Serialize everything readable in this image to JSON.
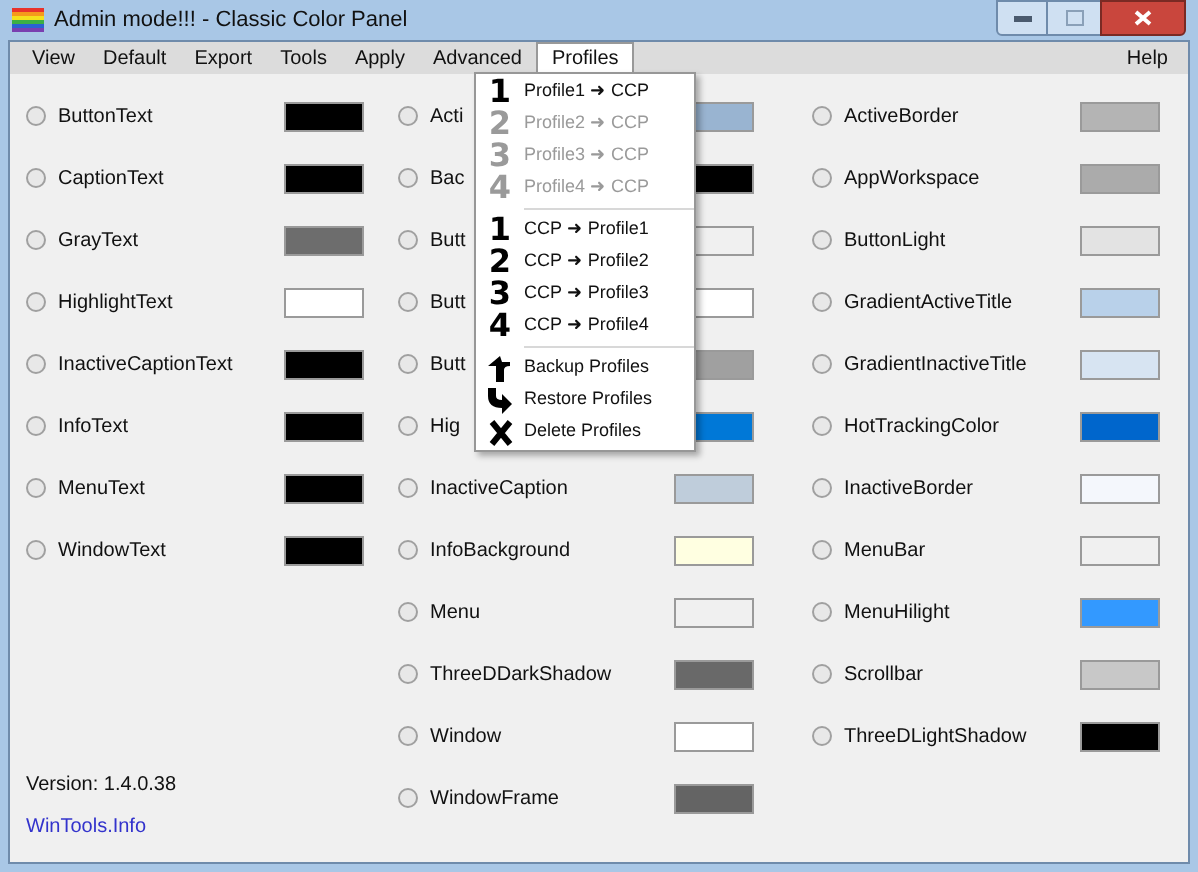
{
  "window": {
    "title": "Admin mode!!! - Classic Color Panel"
  },
  "menu_bar": {
    "items": [
      {
        "label": "View",
        "selected": false
      },
      {
        "label": "Default",
        "selected": false
      },
      {
        "label": "Export",
        "selected": false
      },
      {
        "label": "Tools",
        "selected": false
      },
      {
        "label": "Apply",
        "selected": false
      },
      {
        "label": "Advanced",
        "selected": false
      },
      {
        "label": "Profiles",
        "selected": true
      }
    ],
    "help": "Help"
  },
  "profiles_menu": {
    "groups": [
      [
        {
          "kind": "number",
          "badge": "1",
          "label": "Profile1 ➜ CCP",
          "disabled": false
        },
        {
          "kind": "number",
          "badge": "2",
          "label": "Profile2 ➜ CCP",
          "disabled": true
        },
        {
          "kind": "number",
          "badge": "3",
          "label": "Profile3 ➜ CCP",
          "disabled": true
        },
        {
          "kind": "number",
          "badge": "4",
          "label": "Profile4 ➜ CCP",
          "disabled": true
        }
      ],
      [
        {
          "kind": "number",
          "badge": "1",
          "label": "CCP ➜ Profile1",
          "disabled": false
        },
        {
          "kind": "number",
          "badge": "2",
          "label": "CCP ➜ Profile2",
          "disabled": false
        },
        {
          "kind": "number",
          "badge": "3",
          "label": "CCP ➜ Profile3",
          "disabled": false
        },
        {
          "kind": "number",
          "badge": "4",
          "label": "CCP ➜ Profile4",
          "disabled": false
        }
      ],
      [
        {
          "kind": "backup",
          "label": "Backup Profiles",
          "disabled": false
        },
        {
          "kind": "restore",
          "label": "Restore Profiles",
          "disabled": false
        },
        {
          "kind": "delete",
          "label": "Delete Profiles",
          "disabled": false
        }
      ]
    ]
  },
  "columns": [
    [
      {
        "name": "ButtonText",
        "color": "#000000",
        "selected": false
      },
      {
        "name": "CaptionText",
        "color": "#000000",
        "selected": false
      },
      {
        "name": "GrayText",
        "color": "#6d6d6d",
        "selected": false
      },
      {
        "name": "HighlightText",
        "color": "#ffffff",
        "selected": false
      },
      {
        "name": "InactiveCaptionText",
        "color": "#000000",
        "selected": false
      },
      {
        "name": "InfoText",
        "color": "#000000",
        "selected": false
      },
      {
        "name": "MenuText",
        "color": "#000000",
        "selected": false
      },
      {
        "name": "WindowText",
        "color": "#000000",
        "selected": false
      }
    ],
    [
      {
        "name": "Acti",
        "color": "#99b4d1",
        "selected": false
      },
      {
        "name": "Bac",
        "color": "#000000",
        "selected": false
      },
      {
        "name": "Butt",
        "color": "#f0f0f0",
        "selected": false
      },
      {
        "name": "Butt",
        "color": "#ffffff",
        "selected": false
      },
      {
        "name": "Butt",
        "color": "#a0a0a0",
        "selected": false
      },
      {
        "name": "Hig",
        "color": "#0078d7",
        "selected": false
      },
      {
        "name": "InactiveCaption",
        "color": "#bfcddb",
        "selected": false
      },
      {
        "name": "InfoBackground",
        "color": "#ffffe1",
        "selected": false
      },
      {
        "name": "Menu",
        "color": "#f0f0f0",
        "selected": false
      },
      {
        "name": "ThreeDDarkShadow",
        "color": "#696969",
        "selected": false
      },
      {
        "name": "Window",
        "color": "#ffffff",
        "selected": false
      },
      {
        "name": "WindowFrame",
        "color": "#646464",
        "selected": false
      }
    ],
    [
      {
        "name": "ActiveBorder",
        "color": "#b4b4b4",
        "selected": false
      },
      {
        "name": "AppWorkspace",
        "color": "#ababab",
        "selected": false
      },
      {
        "name": "ButtonLight",
        "color": "#e3e3e3",
        "selected": false
      },
      {
        "name": "GradientActiveTitle",
        "color": "#b9d1ea",
        "selected": false
      },
      {
        "name": "GradientInactiveTitle",
        "color": "#d7e4f2",
        "selected": false
      },
      {
        "name": "HotTrackingColor",
        "color": "#0066cc",
        "selected": false
      },
      {
        "name": "InactiveBorder",
        "color": "#f4f7fc",
        "selected": false
      },
      {
        "name": "MenuBar",
        "color": "#f0f0f0",
        "selected": false
      },
      {
        "name": "MenuHilight",
        "color": "#3399ff",
        "selected": false
      },
      {
        "name": "Scrollbar",
        "color": "#c8c8c8",
        "selected": false
      },
      {
        "name": "ThreeDLightShadow",
        "color": "#000000",
        "selected": false
      }
    ]
  ],
  "footer": {
    "version": "Version: 1.4.0.38",
    "link": "WinTools.Info"
  }
}
